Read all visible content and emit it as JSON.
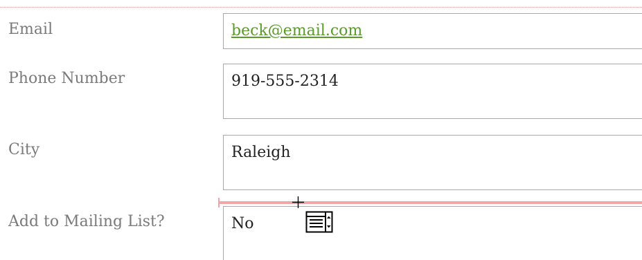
{
  "form": {
    "fields": [
      {
        "label": "Email",
        "value": "beck@email.com"
      },
      {
        "label": "Phone Number",
        "value": "919-555-2314"
      },
      {
        "label": "City",
        "value": "Raleigh"
      },
      {
        "label": "Add to Mailing List?",
        "value": "No"
      }
    ]
  },
  "icons": {
    "crosshair": "crosshair-cursor-icon",
    "control": "list-box-control-icon"
  },
  "colors": {
    "label": "#7a7a7a",
    "link": "#5a9a2a",
    "field_border": "#a8a8a8",
    "guide": "#f0a6a6"
  }
}
